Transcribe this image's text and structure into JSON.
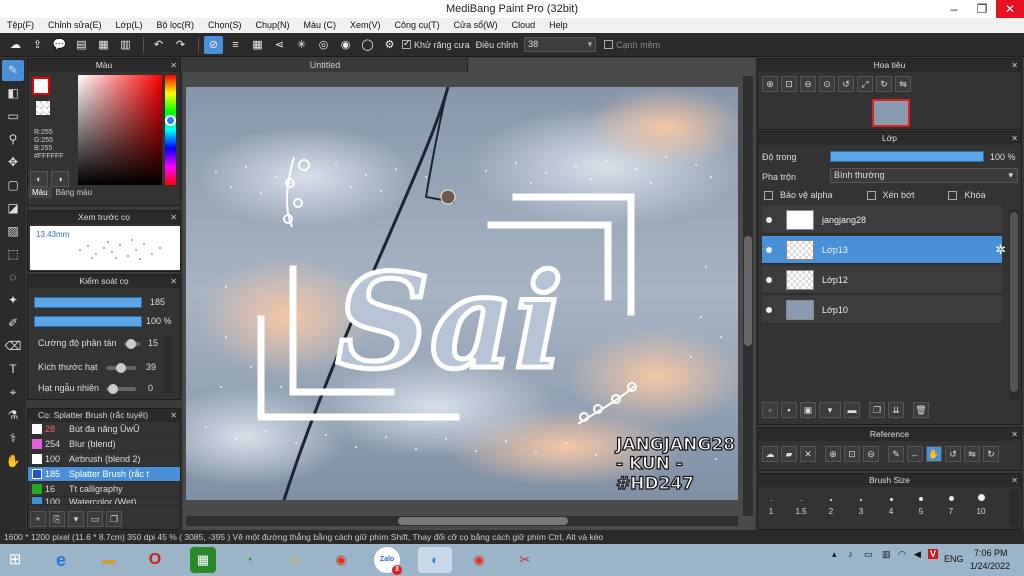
{
  "window": {
    "title": "MediBang Paint Pro (32bit)"
  },
  "menu": [
    "Tệp(F)",
    "Chỉnh sửa(E)",
    "Lớp(L)",
    "Bộ lọc(R)",
    "Chọn(S)",
    "Chụp(N)",
    "Màu (C)",
    "Xem(V)",
    "Công cụ(T)",
    "Cửa sổ(W)",
    "Cloud",
    "Help"
  ],
  "toolbar": {
    "antialias_label": "Khử răng cưa",
    "antialias_checked": true,
    "adjust_label": "Điều chỉnh",
    "adjust_value": "38",
    "smooth_label": "Cạnh mềm",
    "smooth_checked": false
  },
  "color_panel": {
    "title": "Màu",
    "r": "R:255",
    "g": "G:255",
    "b": "B:255",
    "hex": "#FFFFFF",
    "tab_color": "Màu",
    "tab_palette": "Bảng màu"
  },
  "brush_preview": {
    "title": "Xem trước cọ",
    "size": "13.43mm"
  },
  "brush_control": {
    "title": "Kiểm soát cọ",
    "size_value": "185",
    "opacity_value": "100 %",
    "scatter_label": "Cường độ phân tán",
    "scatter_value": "15",
    "grain_label": "Kích thước hạt",
    "grain_value": "39",
    "random_label": "Hạt ngẫu nhiên",
    "random_value": "0"
  },
  "brush_list": {
    "title": "Cọ: Splatter Brush (rắc tuyết)",
    "items": [
      {
        "num": "28",
        "name": "Bút đa năng ŪwŪ",
        "color": "#ffffff"
      },
      {
        "num": "254",
        "name": "Blur (blend)",
        "color": "#e060e0"
      },
      {
        "num": "100",
        "name": "Airbrush (blend 2)",
        "color": "#ffffff"
      },
      {
        "num": "185",
        "name": "Splatter Brush (rắc t",
        "color": "#2255cc"
      },
      {
        "num": "16",
        "name": "Tt calligraphy",
        "color": "#22aa22"
      },
      {
        "num": "100",
        "name": "Watercolor (Wet)",
        "color": "#3b8fd8"
      }
    ]
  },
  "document": {
    "tab": "Untitled",
    "sign_line1": "JANGJANG28",
    "sign_line2": "- KUN -",
    "sign_line3": "#HD247",
    "art_text": "Sai"
  },
  "navigator": {
    "title": "Hoa tiêu"
  },
  "layers": {
    "title": "Lớp",
    "opacity_label": "Độ trong",
    "opacity_value": "100 %",
    "blend_label": "Pha trộn",
    "blend_value": "Bình thường",
    "protect_alpha": "Bảo vệ alpha",
    "clipping": "Xén bớt",
    "lock": "Khóa",
    "items": [
      {
        "name": "jangjang28"
      },
      {
        "name": "Lớp13"
      },
      {
        "name": "Lớp12"
      },
      {
        "name": "Lớp10"
      }
    ]
  },
  "reference": {
    "title": "Reference"
  },
  "brush_size": {
    "title": "Brush Size",
    "sizes": [
      "1",
      "1.5",
      "2",
      "3",
      "4",
      "5",
      "7",
      "10"
    ]
  },
  "status": {
    "text": "1600 * 1200 pixel   (11.6 * 8.7cm)   350 dpi   45 %   ( 3085, -395 )   Vẽ một đường thẳng bằng cách giữ phím Shift, Thay đổi cỡ cọ bằng cách giữ phím Ctrl, Alt và kéo"
  },
  "taskbar": {
    "lang": "ENG",
    "time": "7:06 PM",
    "date": "1/24/2022",
    "zalo_badge": "3"
  }
}
